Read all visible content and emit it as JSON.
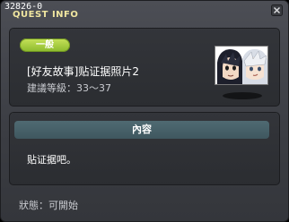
{
  "window": {
    "quest_id": "32826-0",
    "title": "QUEST INFO"
  },
  "quest": {
    "category_badge": "一般",
    "name": "[好友故事]贴证据照片2",
    "level_requirement": "建議等級：33～37"
  },
  "content": {
    "header": "內容",
    "text": "贴证据吧。"
  },
  "footer": {
    "status": "狀態：可開始"
  },
  "colors": {
    "badge": "#9cc63a",
    "title": "#f0e6a0",
    "content_header": "#4a646c"
  }
}
